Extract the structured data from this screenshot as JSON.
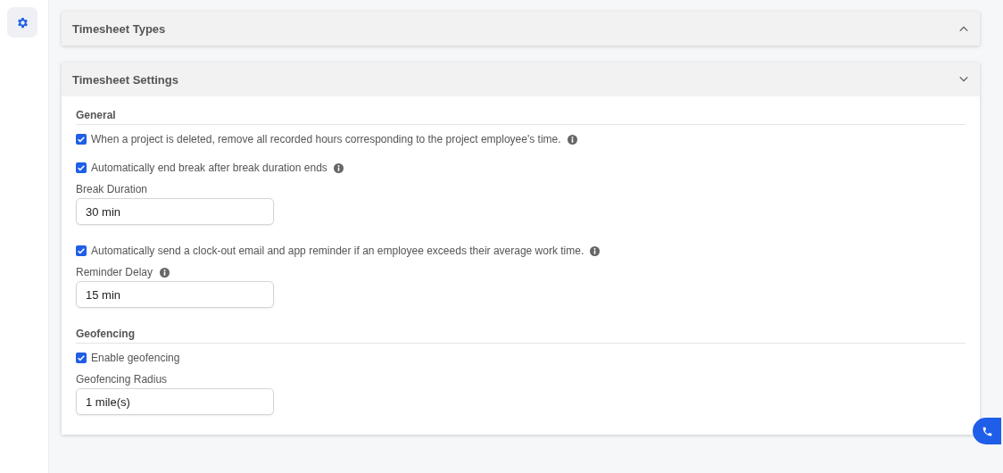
{
  "panels": [
    {
      "title": "Timesheet Types",
      "expanded": false
    },
    {
      "title": "Timesheet Settings",
      "expanded": true,
      "sections": [
        {
          "heading": "General",
          "items": [
            {
              "kind": "checkbox",
              "label": "When a project is deleted, remove all recorded hours corresponding to the project employee's time.",
              "checked": true,
              "info": true
            },
            {
              "kind": "checkbox",
              "label": "Automatically end break after break duration ends",
              "checked": true,
              "info": true
            },
            {
              "kind": "field",
              "label": "Break Duration",
              "value": "30 min",
              "info": false
            },
            {
              "kind": "checkbox",
              "label": "Automatically send a clock-out email and app reminder if an employee exceeds their average work time.",
              "checked": true,
              "info": true
            },
            {
              "kind": "field",
              "label": "Reminder Delay",
              "value": "15 min",
              "info": true
            }
          ]
        },
        {
          "heading": "Geofencing",
          "items": [
            {
              "kind": "checkbox",
              "label": "Enable geofencing",
              "checked": true,
              "info": false
            },
            {
              "kind": "field",
              "label": "Geofencing Radius",
              "value": "1 mile(s)",
              "info": false
            }
          ]
        }
      ]
    }
  ]
}
